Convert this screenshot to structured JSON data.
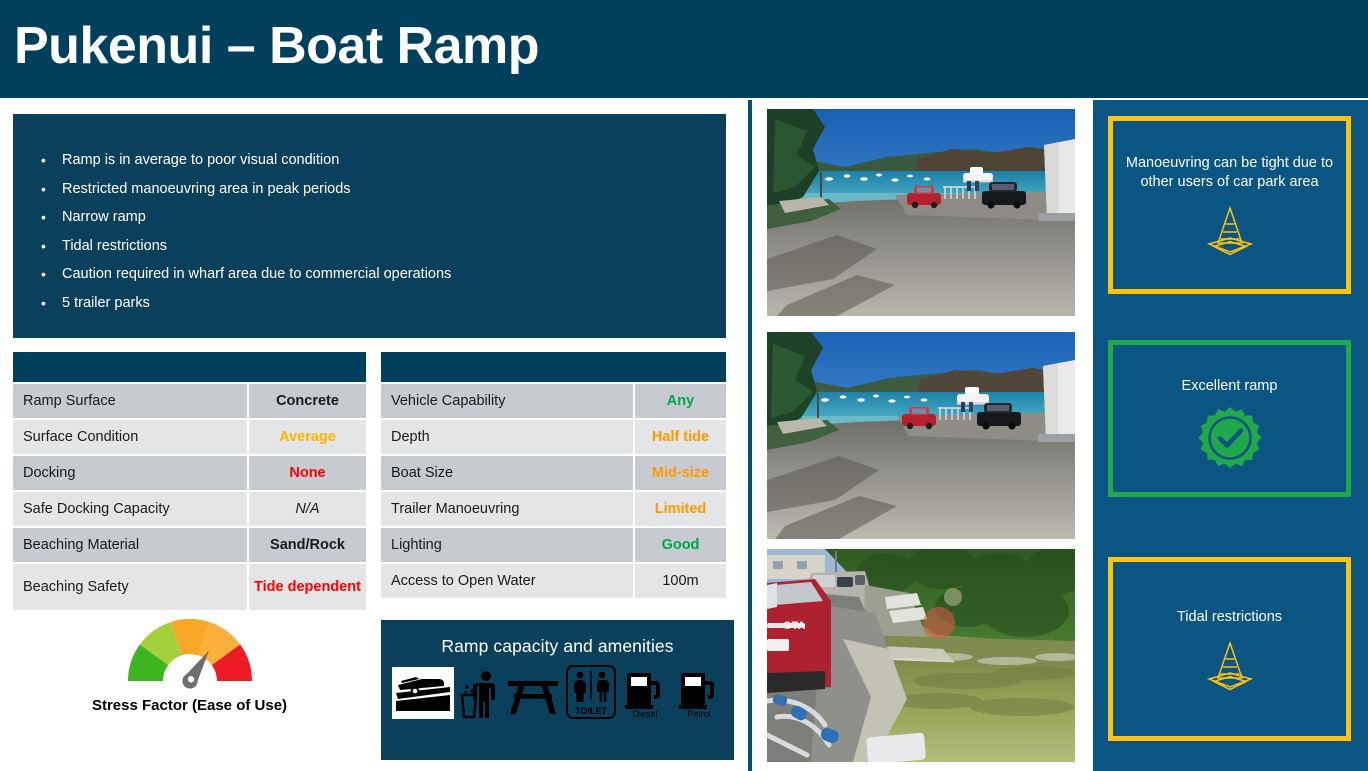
{
  "header": {
    "title": "Pukenui – Boat Ramp",
    "bg_color": "#01405c"
  },
  "bullets_panel": {
    "bg_color": "#0b405c",
    "items": [
      "Ramp is in average to poor visual condition",
      "Restricted manoeuvring area in peak periods",
      "Narrow ramp",
      "Tidal restrictions",
      "Caution required in wharf area due to commercial operations",
      "5 trailer parks"
    ]
  },
  "table_left": {
    "header_label": "",
    "rows": [
      {
        "key": "Ramp Surface",
        "value": "Concrete",
        "style": "bold",
        "color": "#1a1a1a"
      },
      {
        "key": "Surface Condition",
        "value": "Average",
        "style": "bold",
        "color": "#ffb400"
      },
      {
        "key": "Docking",
        "value": "None",
        "style": "bold",
        "color": "#ff0000"
      },
      {
        "key": "Safe Docking Capacity",
        "value": "N/A",
        "style": "italic",
        "color": "#1a1a1a"
      },
      {
        "key": "Beaching Material",
        "value": "Sand/Rock",
        "style": "bold",
        "color": "#1a1a1a"
      },
      {
        "key": "Beaching Safety",
        "value": "Tide dependent",
        "style": "bold",
        "color": "#ff0000"
      }
    ]
  },
  "table_right": {
    "header_label": "",
    "rows": [
      {
        "key": "Vehicle Capability",
        "value": "Any",
        "style": "bold",
        "color": "#00a550"
      },
      {
        "key": "Depth",
        "value": "Half tide",
        "style": "bold",
        "color": "#ff9900"
      },
      {
        "key": "Boat Size",
        "value": "Mid-size",
        "style": "bold",
        "color": "#ff9900"
      },
      {
        "key": "Trailer Manoeuvring",
        "value": "Limited",
        "style": "bold",
        "color": "#ff9900"
      },
      {
        "key": "Lighting",
        "value": "Good",
        "style": "bold",
        "color": "#00a550"
      },
      {
        "key": "Access to Open Water",
        "value": "100m",
        "style": "normal",
        "color": "#1a1a1a"
      }
    ]
  },
  "gauge": {
    "caption": "Stress Factor (Ease of Use)",
    "needle_position_label": "orange",
    "segments": [
      {
        "name": "very-good",
        "color": "#3cb521"
      },
      {
        "name": "good",
        "color": "#a3d13b"
      },
      {
        "name": "moderate",
        "color": "#f9a825"
      },
      {
        "name": "poor",
        "color": "#fbb03b"
      },
      {
        "name": "very-poor",
        "color": "#ed1c24"
      }
    ]
  },
  "amenities": {
    "title": "Ramp capacity and amenities",
    "icons": [
      {
        "name": "boat-ramp-icon",
        "label": ""
      },
      {
        "name": "rubbish-bin-icon",
        "label": ""
      },
      {
        "name": "picnic-table-icon",
        "label": ""
      },
      {
        "name": "toilet-icon",
        "label": "TOILET"
      },
      {
        "name": "diesel-pump-icon",
        "label": "Diesel"
      },
      {
        "name": "petrol-pump-icon",
        "label": "Petrol"
      }
    ]
  },
  "photos": [
    {
      "name": "photo-ramp-harbour-wide",
      "caption": ""
    },
    {
      "name": "photo-ramp-harbour-wide-2",
      "caption": ""
    },
    {
      "name": "photo-ramp-trailer-launch",
      "caption": ""
    }
  ],
  "sidebar": {
    "bg_color": "#0b5582",
    "callouts": [
      {
        "text": "Manoeuvring can be tight due to other users of car park area",
        "border_color": "#ffc20e",
        "icon": "traffic-cone-icon"
      },
      {
        "text": "Excellent ramp",
        "border_color": "#21a84a",
        "icon": "check-rosette-icon"
      },
      {
        "text": "Tidal restrictions",
        "border_color": "#ffc20e",
        "icon": "traffic-cone-icon"
      }
    ]
  }
}
